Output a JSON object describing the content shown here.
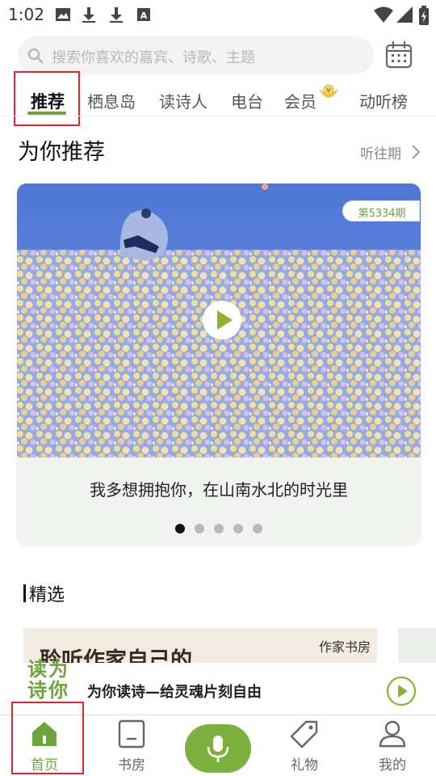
{
  "status_bar": {
    "time": "1:02",
    "icons": [
      "image-icon",
      "download-icon",
      "download-icon",
      "text-icon",
      "wifi-icon",
      "signal-icon",
      "battery-icon"
    ]
  },
  "search": {
    "placeholder": "搜索你喜欢的嘉宾、诗歌、主题",
    "calendar_icon": "calendar-icon"
  },
  "tabs": [
    {
      "label": "推荐",
      "active": true
    },
    {
      "label": "栖息岛",
      "active": false
    },
    {
      "label": "读诗人",
      "active": false
    },
    {
      "label": "电台",
      "active": false
    },
    {
      "label": "会员",
      "active": false,
      "badge": "vip-badge-icon"
    },
    {
      "label": "动听榜",
      "active": false
    }
  ],
  "recommend": {
    "title": "为你推荐",
    "history_link": "听往期",
    "card": {
      "issue": "第5334期",
      "caption": "我多想拥抱你，在山南水北的时光里"
    },
    "carousel_dots": 5,
    "active_dot": 0
  },
  "selection": {
    "title": "精选",
    "card_text": "聆听作家自己的",
    "card_logo": "作家书房"
  },
  "mini_player": {
    "logo": "读为诗你",
    "title": "为你读诗—给灵魂片刻自由"
  },
  "bottom_nav": [
    {
      "label": "首页",
      "icon": "home-icon",
      "active": true
    },
    {
      "label": "书房",
      "icon": "book-icon",
      "active": false
    },
    {
      "label": "",
      "icon": "mic-icon",
      "active": false
    },
    {
      "label": "礼物",
      "icon": "tag-icon",
      "active": false
    },
    {
      "label": "我的",
      "icon": "profile-icon",
      "active": false
    }
  ],
  "colors": {
    "accent": "#6ea43c",
    "highlight": "#e0262d"
  }
}
